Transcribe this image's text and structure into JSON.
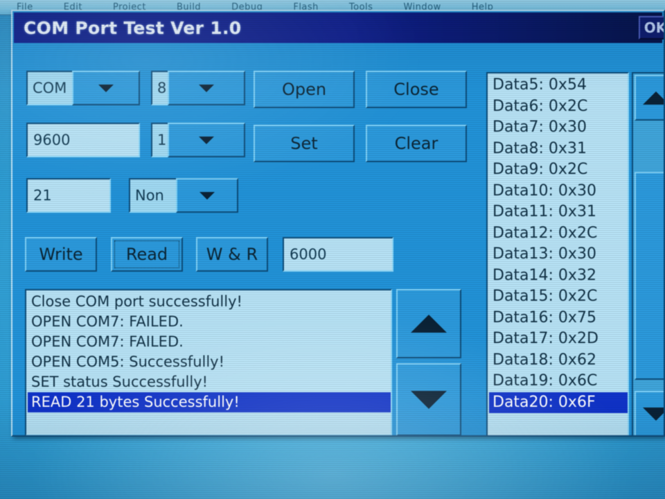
{
  "desktop": {
    "menubar_items": [
      "File",
      "Edit",
      "Project",
      "Build",
      "Debug",
      "Flash",
      "Tools",
      "Window",
      "Help"
    ]
  },
  "dialog": {
    "title": "COM Port Test Ver 1.0",
    "ok_label": "OK"
  },
  "settings": {
    "port": {
      "value": "COM",
      "caret": "chevron-down"
    },
    "databits": {
      "value": "8",
      "caret": "chevron-down"
    },
    "baudrate": {
      "value": "9600"
    },
    "stopbits": {
      "value": "1",
      "caret": "chevron-down"
    },
    "length": {
      "value": "21"
    },
    "parity": {
      "value": "Non",
      "caret": "chevron-down"
    },
    "timeout": {
      "value": "6000"
    }
  },
  "actions": {
    "open": "Open",
    "close": "Close",
    "set": "Set",
    "clear": "Clear",
    "write": "Write",
    "read": "Read",
    "write_and_read": "W & R"
  },
  "log": {
    "entries": [
      {
        "text": "Close COM port successfully!",
        "selected": false
      },
      {
        "text": "OPEN COM7: FAILED.",
        "selected": false
      },
      {
        "text": "OPEN COM7: FAILED.",
        "selected": false
      },
      {
        "text": "OPEN COM5: Successfully!",
        "selected": false
      },
      {
        "text": "SET status Successfully!",
        "selected": false
      },
      {
        "text": "READ 21 bytes Successfully!",
        "selected": true
      }
    ],
    "scroll_up_icon": "triangle-up-icon",
    "scroll_down_icon": "triangle-down-icon"
  },
  "data_list": {
    "entries": [
      {
        "text": "Data5: 0x54",
        "selected": false
      },
      {
        "text": "Data6: 0x2C",
        "selected": false
      },
      {
        "text": "Data7: 0x30",
        "selected": false
      },
      {
        "text": "Data8: 0x31",
        "selected": false
      },
      {
        "text": "Data9: 0x2C",
        "selected": false
      },
      {
        "text": "Data10: 0x30",
        "selected": false
      },
      {
        "text": "Data11: 0x31",
        "selected": false
      },
      {
        "text": "Data12: 0x2C",
        "selected": false
      },
      {
        "text": "Data13: 0x30",
        "selected": false
      },
      {
        "text": "Data14: 0x32",
        "selected": false
      },
      {
        "text": "Data15: 0x2C",
        "selected": false
      },
      {
        "text": "Data16: 0x75",
        "selected": false
      },
      {
        "text": "Data17: 0x2D",
        "selected": false
      },
      {
        "text": "Data18: 0x62",
        "selected": false
      },
      {
        "text": "Data19: 0x6C",
        "selected": false
      },
      {
        "text": "Data20: 0x6F",
        "selected": true
      }
    ],
    "scroll_up_icon": "triangle-up-icon",
    "scroll_down_icon": "triangle-down-icon"
  },
  "colors": {
    "dialog_face": "#2191d6",
    "titlebar": "#101f8e",
    "field_face": "#b5e0f3",
    "selection": "#1033c8",
    "selection_text": "#ffffff",
    "text": "#123246",
    "desktop": "#3aabdd"
  }
}
